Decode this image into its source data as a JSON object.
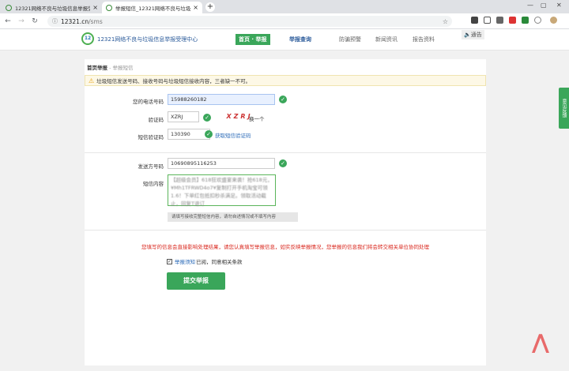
{
  "browser": {
    "tab1_title": "12321网络不良与垃圾信息举报受...",
    "tab2_title": "举报短信_12321网络不良与垃圾...",
    "url_host": "12321.cn",
    "url_path": "/sms"
  },
  "header": {
    "logo_text": "12321网络不良与垃圾信息举报受理中心",
    "nav": [
      "首页 · 举报",
      "举报查询",
      "防骗预警",
      "新闻资讯",
      "报告资料"
    ],
    "sound_label": "通告"
  },
  "breadcrumb": {
    "home": "首页举报",
    "current": "举报短信"
  },
  "warning": "垃圾短信发送号码、接收号码与垃圾短信接收内容，三者缺一不可。",
  "form": {
    "phone_label": "您的电话号码",
    "phone_value": "15988260182",
    "captcha_label": "验证码",
    "captcha_value": "XZRJ",
    "captcha_image_text": "XZRJ",
    "refresh_label": "换一个",
    "sms_code_label": "短信验证码",
    "sms_code_value": "130390",
    "get_code_label": "获取短信验证码",
    "sender_label": "发送方号码",
    "sender_value": "10690895116253",
    "content_label": "短信内容",
    "content_value": "【超级会员】618狂欢盛宴来袭！抢618元，¥Mh1TFRWD4o7¥复制打开手机淘宝可领1.6！下单红包抵扣秒杀满足。领取活动截止，回复T退订",
    "content_hint": "请填写接收完整短信内容，请勿自述情况或不填写内容"
  },
  "notice": "您填写的信息会直接影响处理结果，请您认真填写举报信息，如实反映举报情况，您举报的信息我们将会转交相关单位协同处理",
  "agree": {
    "link": "举报须知",
    "text": "已阅，同意相关条款"
  },
  "submit_label": "提交举报",
  "side_button": "意见反馈"
}
